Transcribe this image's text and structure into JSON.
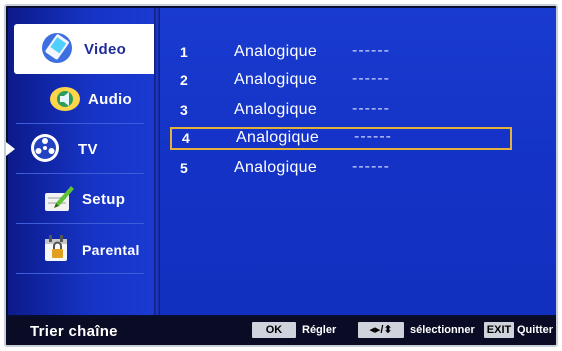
{
  "sidebar": {
    "items": [
      {
        "label": "Video",
        "icon": "video-icon"
      },
      {
        "label": "Audio",
        "icon": "audio-icon"
      },
      {
        "label": "TV",
        "icon": "tv-reel-icon"
      },
      {
        "label": "Setup",
        "icon": "setup-icon"
      },
      {
        "label": "Parental",
        "icon": "parental-lock-icon"
      }
    ],
    "selected_label": "Video",
    "pointer_item": "TV"
  },
  "channels": [
    {
      "num": "1",
      "name": "Analogique",
      "value": "------"
    },
    {
      "num": "2",
      "name": "Analogique",
      "value": "------"
    },
    {
      "num": "3",
      "name": "Analogique",
      "value": "------"
    },
    {
      "num": "4",
      "name": "Analogique",
      "value": "------"
    },
    {
      "num": "5",
      "name": "Analogique",
      "value": "------"
    }
  ],
  "highlighted_channel": "4",
  "footer": {
    "title": "Trier chaîne",
    "ok_key": "OK",
    "ok_text": "Régler",
    "nav_key": "◂▸/⬍",
    "nav_text": "sélectionner",
    "exit_key": "EXIT",
    "exit_text": "Quitter"
  },
  "colors": {
    "content_bg": "#1633c6",
    "highlight_border": "#e3b23c",
    "frame_bg": "#0a0e2e"
  }
}
